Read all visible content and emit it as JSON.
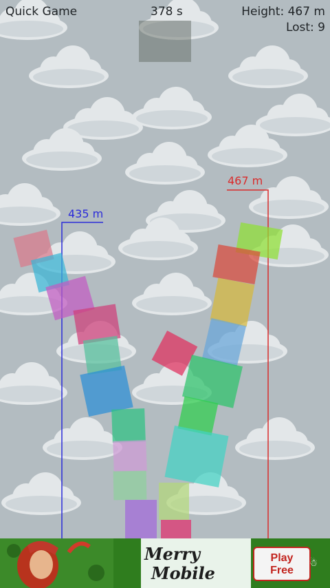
{
  "hud": {
    "mode": "Quick Game",
    "time": "378 s",
    "height": "Height: 467 m",
    "lost": "Lost: 9"
  },
  "markers": {
    "left": {
      "label": "435 m",
      "color": "#2b2bd9"
    },
    "right": {
      "label": "467 m",
      "color": "#d92b2b"
    }
  },
  "ad": {
    "title_line1": "Merry",
    "title_line2": "Mobile",
    "button_line1": "Play",
    "button_line2": "Free"
  },
  "colors": {
    "background": "#b3bcc1",
    "ad_green": "#2f7d1e"
  }
}
